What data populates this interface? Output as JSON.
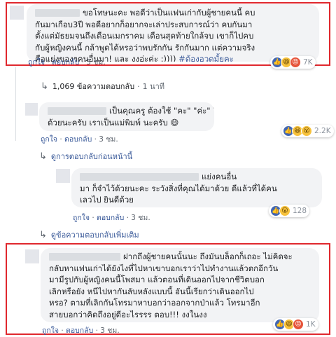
{
  "comment1": {
    "lines": [
      "ขอโทษนะคะ พอดีว่าเป็นแฟนเก่ากับผู้ชายคนนี้ คบ",
      "กันมาเกือบ3ปี พอดีอยากก็อยากจะเล่าประสบการณ์ว่า คบกันมา",
      "ตั้งแต่มัธยมจนถึงเดือนเมกราคม เดือนสุดท้ายใกล้จบ เขาก็ไปคบ",
      "กับผู้หญิงคนนี้ กล้าพูดได้หรอว่าพบรักกัน รักกันมาก แต่ความจริง",
      "คือแย่งของๆคนอื่นมา! และ งงอ่ะค่ะ :))))"
    ],
    "hashtag": "#ต้องอวดมั้ยคะ",
    "like": "ถูกใจ",
    "reply": "ตอบกลับ",
    "time": "3 ชม.",
    "reaction_count": "7K"
  },
  "replies_summary": {
    "text": "1,069 ข้อความตอบกลับ",
    "time": "1 นาที"
  },
  "comment2": {
    "lines": [
      "เป็นคุณครู ต้องใช้ \"คะ\" \"ค่ะ\" ให้ถูกต้อง",
      "ด้วยนะครับ เราเป็นแม่พิมพ์ นะครับ 😄"
    ],
    "like": "ถูกใจ",
    "reply": "ตอบกลับ",
    "time": "3 ชม.",
    "reaction_count": "2.2K"
  },
  "older_replies": {
    "text": "ดูการตอบกลับก่อนหน้านี้"
  },
  "comment3": {
    "lines": [
      "แย่งคนอื่น",
      "มา ก็จำไว้ด้วยนะคะ ระวังสิ่งที่คุณได้มาด้วย ดีแล้วที่ได้คน",
      "เลวไป ยินดีด้วย"
    ],
    "like": "ถูกใจ",
    "reply": "ตอบกลับ",
    "time": "3 ชม.",
    "reaction_count": "128"
  },
  "more_replies": {
    "text": "ดูข้อความตอบกลับเพิ่มเติม"
  },
  "comment4": {
    "lines": [
      "ฝากถึงผู้ชายคนนั้นนะ ถึงมันบล็อกก็เถอะ ไม่คิดจะ",
      "กลับหาแฟนเก่าได้ยังไงที่ไปหาเขาบอกเราว่าไปทำงานแล้วตกอีกวัน",
      "มามีรูปกับผู้หญิงคนนี้โพสมา แล้วตอนที่เดินออกไปจากชีวิตบอก",
      "เลิกหรือยัง หนีไปหากันลับหลังแบบนี้ อันนี้เรียกว่าเดินออกไป",
      "หรอ? ตามที่เลิกกันโทรมาหาบอกว่าออกจากป่าแล้ว โทรมาอีก",
      "สายบอกว่าคิดถึงอยู่ดีอะไรรรร ตอบ!!! งงในงง"
    ],
    "like": "ถูกใจ",
    "reply": "ตอบกลับ",
    "time": "3 ชม.",
    "reaction_count": "1K"
  },
  "colors": {
    "highlight": "#e0282e",
    "link": "#385898",
    "bubble": "#f2f3f5"
  }
}
